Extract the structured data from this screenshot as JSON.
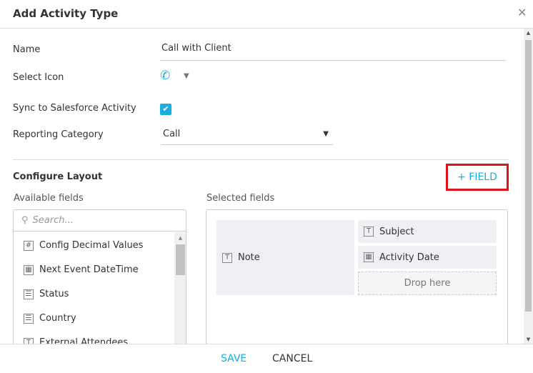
{
  "dialog": {
    "title": "Add Activity Type",
    "close_icon": "close-icon"
  },
  "form": {
    "name_label": "Name",
    "name_value": "Call with Client",
    "icon_label": "Select Icon",
    "icon": "phone-icon",
    "sync_label": "Sync to Salesforce Activity",
    "sync_checked": true,
    "category_label": "Reporting Category",
    "category_value": "Call"
  },
  "layout": {
    "title": "Configure Layout",
    "add_field": "+ FIELD",
    "available_label": "Available fields",
    "selected_label": "Selected fields",
    "search_placeholder": "Search...",
    "available": [
      {
        "label": "Config Decimal Values",
        "icon": "#"
      },
      {
        "label": "Next Event DateTime",
        "icon": "▦"
      },
      {
        "label": "Status",
        "icon": "☰"
      },
      {
        "label": "Country",
        "icon": "☰"
      },
      {
        "label": "External Attendees",
        "icon": "T"
      }
    ],
    "selected": {
      "left": {
        "label": "Note",
        "icon": "T"
      },
      "right": [
        {
          "label": "Subject",
          "icon": "T"
        },
        {
          "label": "Activity Date",
          "icon": "▦"
        }
      ],
      "drop": "Drop here"
    }
  },
  "footer": {
    "save": "SAVE",
    "cancel": "CANCEL"
  },
  "colors": {
    "accent": "#1aaee0",
    "highlight": "#e0111b"
  }
}
